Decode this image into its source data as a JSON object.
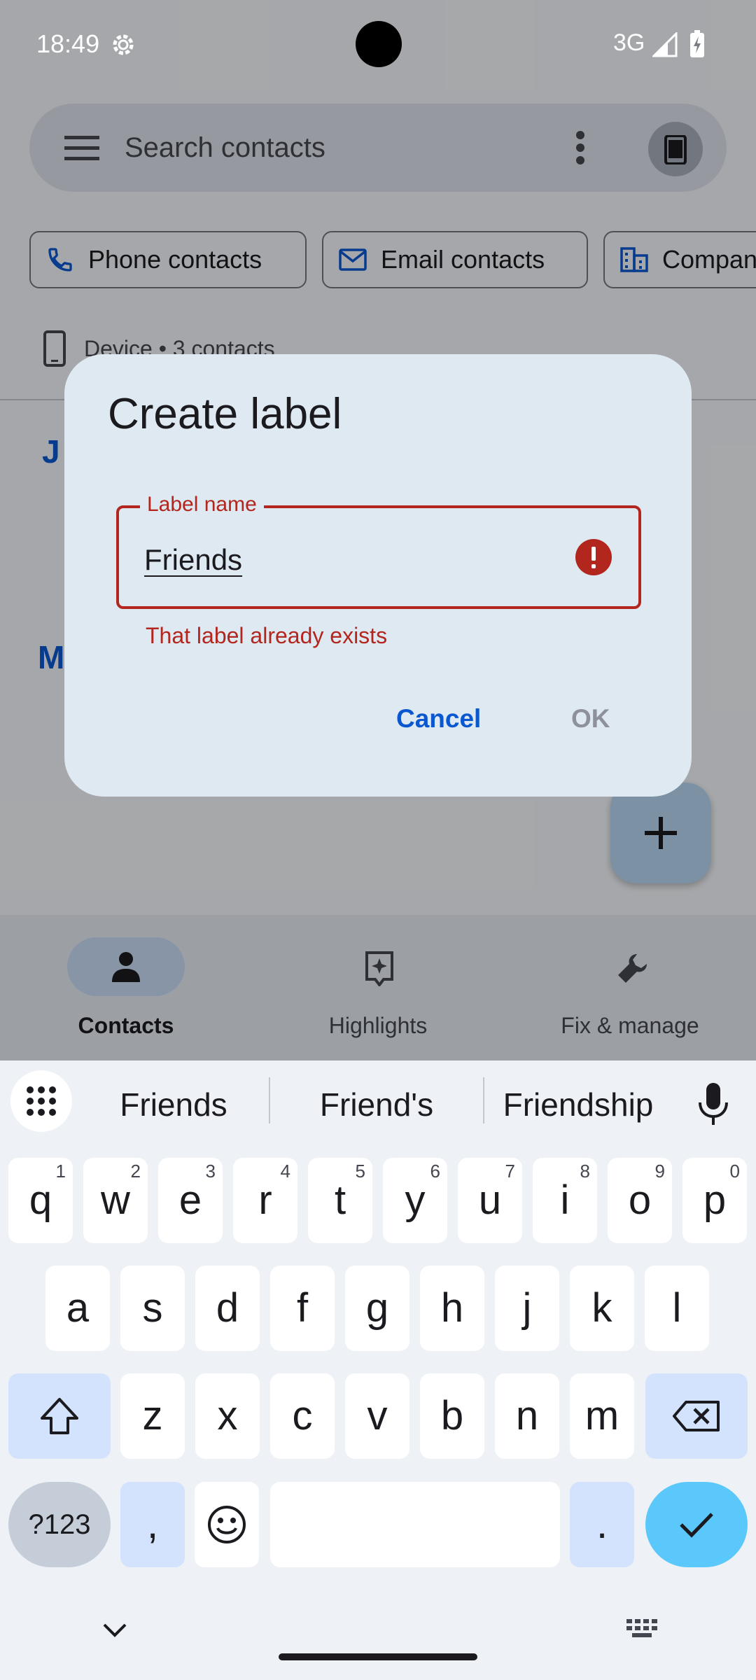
{
  "status_bar": {
    "time": "18:49",
    "network": "3G"
  },
  "app": {
    "search_placeholder": "Search contacts",
    "chips": [
      {
        "label": "Phone contacts",
        "icon": "phone-icon"
      },
      {
        "label": "Email contacts",
        "icon": "email-icon"
      },
      {
        "label": "Companies",
        "icon": "company-icon"
      }
    ],
    "account_label": "Device • 3 contacts",
    "section_letters": [
      "J",
      "M"
    ],
    "bottom_nav": [
      {
        "label": "Contacts",
        "icon": "person-icon",
        "active": true
      },
      {
        "label": "Highlights",
        "icon": "highlights-icon",
        "active": false
      },
      {
        "label": "Fix & manage",
        "icon": "wrench-icon",
        "active": false
      }
    ]
  },
  "dialog": {
    "title": "Create label",
    "field_label": "Label name",
    "field_value": "Friends",
    "error_text": "That label already exists",
    "cancel_label": "Cancel",
    "ok_label": "OK"
  },
  "keyboard": {
    "suggestions": [
      "Friends",
      "Friend's",
      "Friendship"
    ],
    "rows": [
      [
        {
          "k": "q",
          "h": "1"
        },
        {
          "k": "w",
          "h": "2"
        },
        {
          "k": "e",
          "h": "3"
        },
        {
          "k": "r",
          "h": "4"
        },
        {
          "k": "t",
          "h": "5"
        },
        {
          "k": "y",
          "h": "6"
        },
        {
          "k": "u",
          "h": "7"
        },
        {
          "k": "i",
          "h": "8"
        },
        {
          "k": "o",
          "h": "9"
        },
        {
          "k": "p",
          "h": "0"
        }
      ],
      [
        {
          "k": "a"
        },
        {
          "k": "s"
        },
        {
          "k": "d"
        },
        {
          "k": "f"
        },
        {
          "k": "g"
        },
        {
          "k": "h"
        },
        {
          "k": "j"
        },
        {
          "k": "k"
        },
        {
          "k": "l"
        }
      ],
      [
        {
          "k": "z"
        },
        {
          "k": "x"
        },
        {
          "k": "c"
        },
        {
          "k": "v"
        },
        {
          "k": "b"
        },
        {
          "k": "n"
        },
        {
          "k": "m"
        }
      ]
    ],
    "symbols_label": "?123",
    "comma_label": ",",
    "period_label": "."
  },
  "colors": {
    "accent": "#0b57d0",
    "error": "#b3261e",
    "enter_key": "#5ac8fa"
  }
}
